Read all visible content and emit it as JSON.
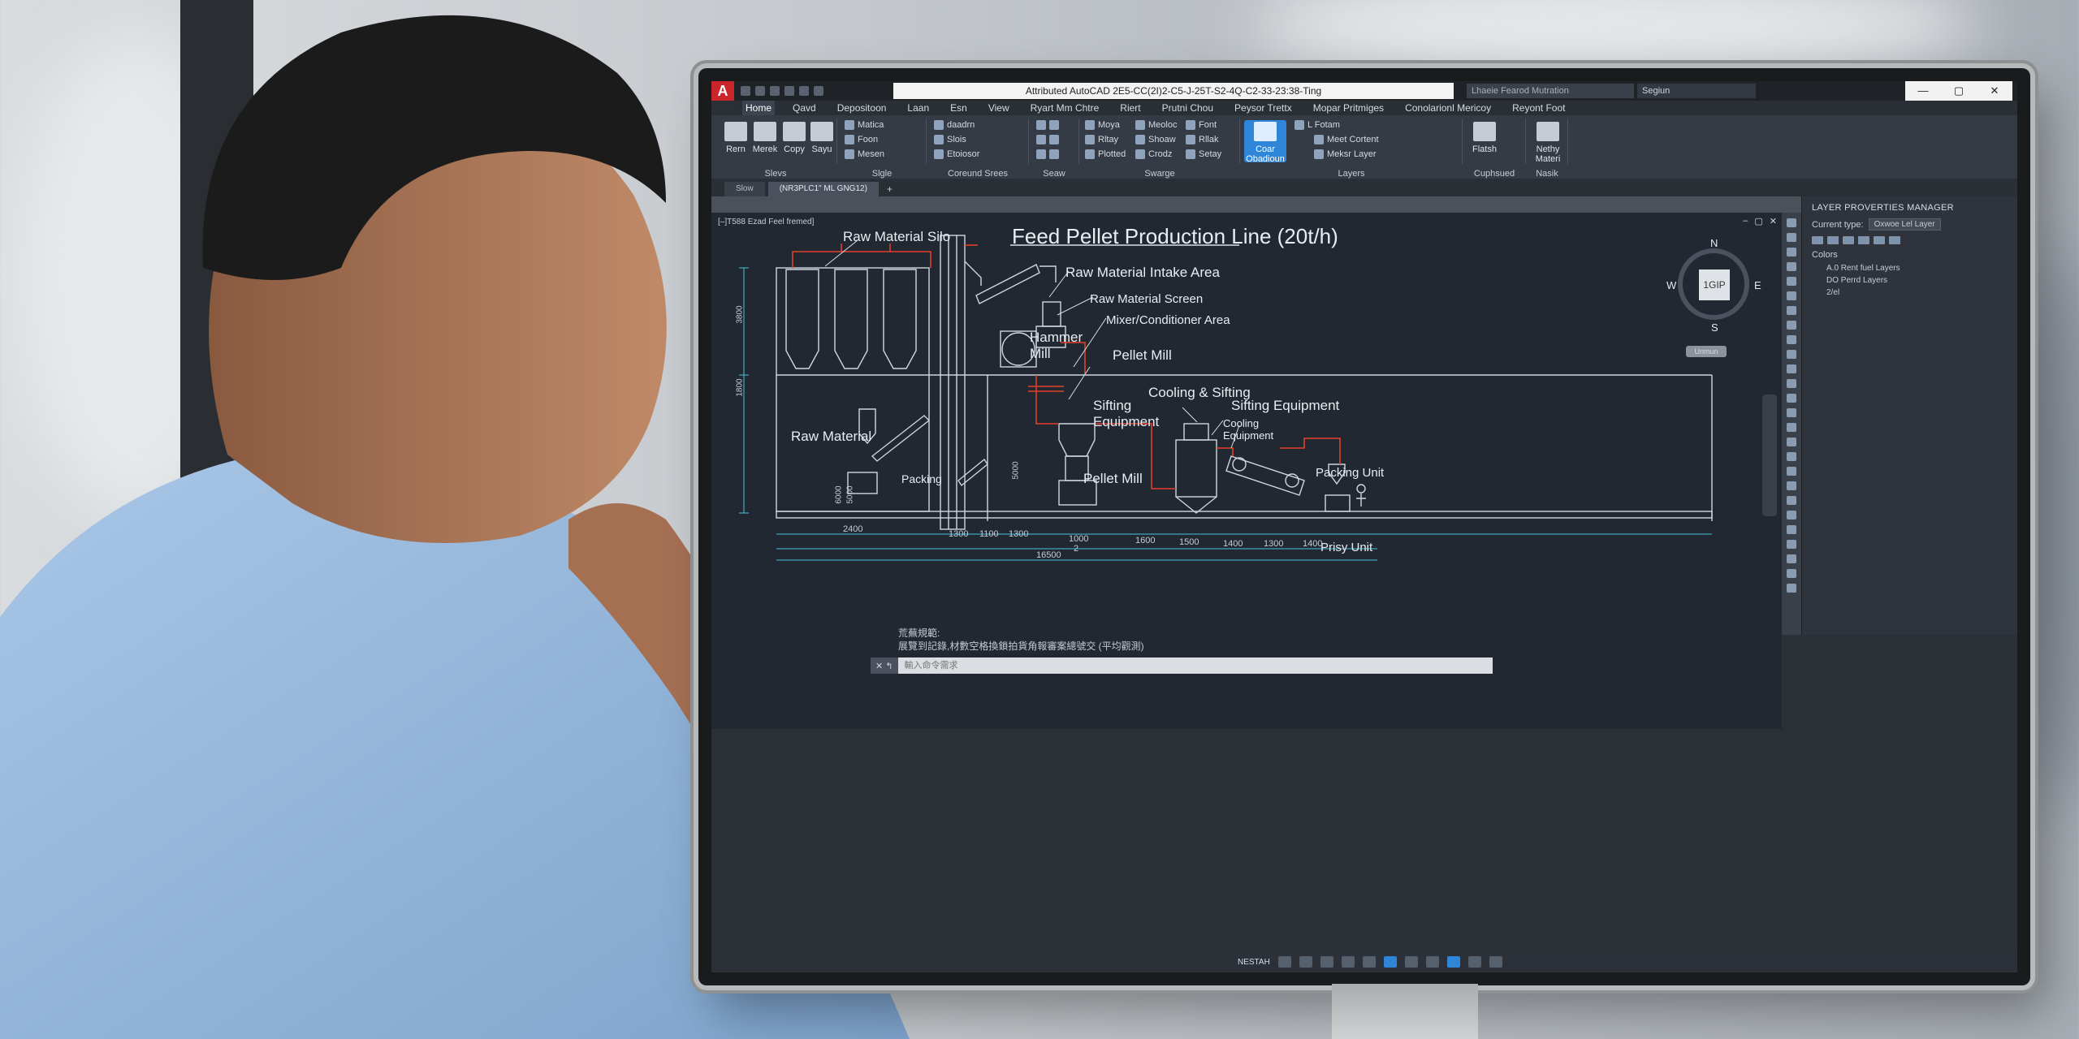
{
  "app": {
    "logo": "A",
    "window_title": "Attributed AutoCAD 2E5-CC(2I)2-C5-J-25T-S2-4Q-C2-33-23:38-Ting",
    "search_placeholder": "Lhaeie Fearod Mutration",
    "signin_label": "Segiun",
    "window_controls": [
      "—",
      "▢",
      "✕"
    ]
  },
  "ribbon": {
    "tabs": [
      "Home",
      "Qavd",
      "Depositoon",
      "Laan",
      "Esn",
      "View",
      "Ryart Mm Chtre",
      "Riert",
      "Prutni Chou",
      "Peysor Trettx",
      "Mopar Pritmiges",
      "Conolarionl Mericoy",
      "Reyont Foot"
    ],
    "active_tab": "Home",
    "draw_tools": [
      "Rern",
      "Merek",
      "Copy",
      "Sayu"
    ],
    "modify_tools": [
      "Matica",
      "Foon",
      "Mesen"
    ],
    "annot_tools": [
      "daadrn",
      "Slois",
      "Etoiosor"
    ],
    "prop_tools": [
      "Moya",
      "Rltay",
      "Plotted"
    ],
    "swarge_tools": [
      "Meoloc",
      "Shoaw",
      "Crodz"
    ],
    "font_tools": [
      "Font",
      "Rllak",
      "Setay"
    ],
    "layer_big": "Coar Obadioun",
    "layer_tools": [
      "L Fotam",
      "Meet Cortent",
      "Meksr Layer"
    ],
    "flatsh_label": "Flatsh",
    "nearby_label": "Nethy Materi",
    "panel_labels": [
      "Slevs",
      "Slgle",
      "Coreund Srees",
      "Seaw",
      "Swarge",
      "Layers",
      "Cuphsued",
      "Nasik"
    ]
  },
  "doc_tabs": [
    "Slow",
    "(NR3PLC1\" ML GNG12)"
  ],
  "drawing": {
    "view_label": "[–]T588 Ezad Feel fremed]",
    "title": "Feed Pellet Production Line (20t/h)",
    "compass": {
      "n": "N",
      "s": "S",
      "e": "E",
      "w": "W",
      "center": "1GIP",
      "under": "Unmun"
    },
    "labels": {
      "silo": "Raw Material Silo",
      "intake": "Raw Material Intake Area",
      "screen": "Raw Material Screen",
      "mixer": "Mixer/Conditioner Area",
      "hammer": "Hammer Mill",
      "pellet_top": "Pellet Mill",
      "cooling_sifting": "Cooling & Sifting",
      "sifting_equip": "Sifting Equipment",
      "sifting_right": "Sifting Equipment",
      "cooling_equip": "Cooling Equipment",
      "raw_material": "Raw Material",
      "packing": "Packing",
      "pellet_bottom": "Pellet Mill",
      "packing_unit": "Packing Unit",
      "prisy_unit": "Prisy Unit"
    },
    "dims": {
      "left_top": "3800",
      "left_mid": "1800",
      "mid_a": "5000",
      "mid_b": "6000",
      "mid_c": "5000",
      "bottom": [
        "2400",
        "1300",
        "1100",
        "1300",
        "1000",
        "1600",
        "1500",
        "1400",
        "1300",
        "1400"
      ],
      "overall": "16500",
      "under_1000": "2"
    }
  },
  "command": {
    "history_1": "荒蕪規範:",
    "history_2": "展覽到記錄,材數空格換鎖拍貨角報審案總號交 (平均觀測)",
    "placeholder": "輸入命令需求",
    "buttons": "✕ ↰"
  },
  "layer_palette": {
    "title": "LAYER PROVERTIES MANAGER",
    "current_type_label": "Current type:",
    "current_type_value": "Oxwoe Lel Layer",
    "colors_label": "Colors",
    "tree": [
      "A.0 Rent fuel Layers",
      "DO Perrd Layers",
      "2/el"
    ]
  },
  "status": {
    "label": "NESTAH"
  }
}
